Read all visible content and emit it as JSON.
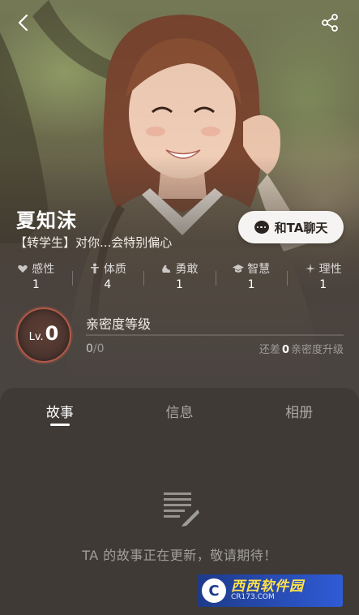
{
  "profile": {
    "name": "夏知沫",
    "tagline": "【转学生】对你...会特别偏心"
  },
  "actions": {
    "chat_label": "和TA聊天"
  },
  "stats": [
    {
      "label": "感性",
      "value": "1",
      "icon": "heart-hands-icon"
    },
    {
      "label": "体质",
      "value": "4",
      "icon": "person-icon"
    },
    {
      "label": "勇敢",
      "value": "1",
      "icon": "arm-icon"
    },
    {
      "label": "智慧",
      "value": "1",
      "icon": "graduation-cap-icon"
    },
    {
      "label": "理性",
      "value": "1",
      "icon": "sparkle-icon"
    }
  ],
  "intimacy": {
    "level_prefix": "Lv.",
    "level": "0",
    "title": "亲密度等级",
    "current": "0",
    "separator": "/",
    "max": "0",
    "hint_prefix": "还差",
    "hint_value": "0",
    "hint_suffix": "亲密度升级",
    "progress_fraction": 0
  },
  "tabs": [
    {
      "label": "故事",
      "active": true
    },
    {
      "label": "信息",
      "active": false
    },
    {
      "label": "相册",
      "active": false
    }
  ],
  "story": {
    "empty_text": "TA 的故事正在更新，敬请期待！"
  },
  "watermark": {
    "logo": "C",
    "main": "西西软件园",
    "sub": "CR173.COM"
  },
  "colors": {
    "accent_ring": "#b35a48",
    "panel": "#3f3a36",
    "chat_button": "#f6f4f2"
  }
}
